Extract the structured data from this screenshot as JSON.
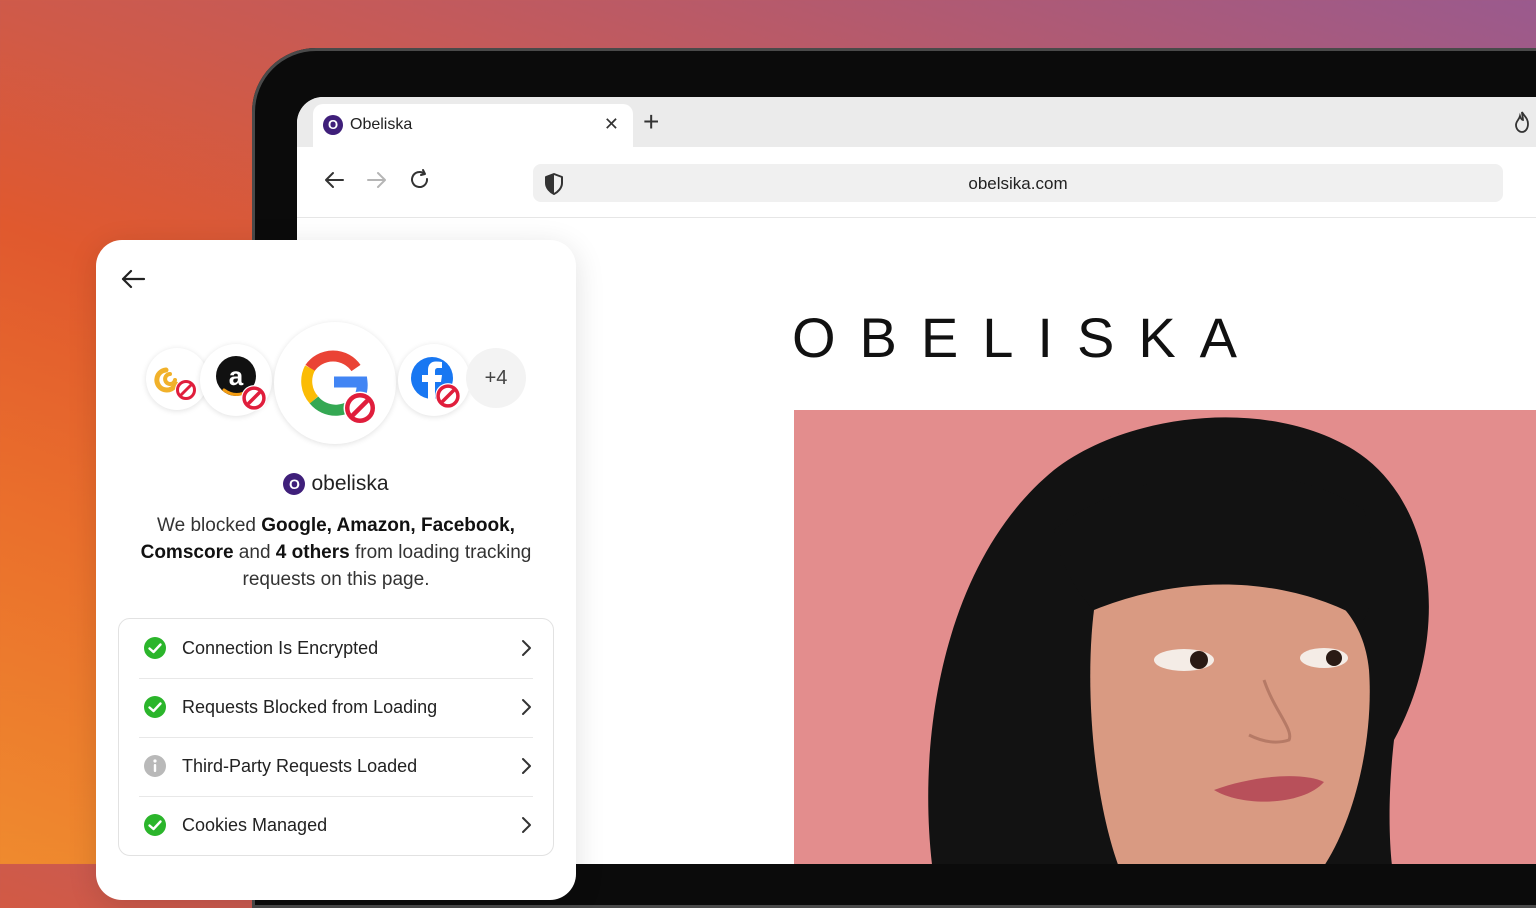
{
  "browser": {
    "tab_title": "Obeliska",
    "tab_favicon_letter": "O",
    "url": "obelsika.com"
  },
  "website": {
    "logo_text": "OBELISKA"
  },
  "panel": {
    "trackers": [
      {
        "name": "Comscore",
        "icon": "comscore-icon"
      },
      {
        "name": "Amazon",
        "icon": "amazon-icon"
      },
      {
        "name": "Google",
        "icon": "google-icon"
      },
      {
        "name": "Facebook",
        "icon": "facebook-icon"
      }
    ],
    "more_count": "+4",
    "site_badge_letter": "O",
    "site_name": "obeliska",
    "summary": {
      "prefix": "We blocked ",
      "bold_1": "Google, Amazon, Facebook,",
      "bold_2": "Comscore",
      "middle": " and ",
      "bold_3": "4 others",
      "suffix": " from loading tracking requests on this page."
    },
    "items": [
      {
        "label": "Connection Is Encrypted",
        "status": "ok",
        "icon": "check-circle-icon"
      },
      {
        "label": "Requests Blocked from Loading",
        "status": "ok",
        "icon": "check-circle-icon"
      },
      {
        "label": "Third-Party Requests Loaded",
        "status": "info",
        "icon": "info-circle-icon"
      },
      {
        "label": "Cookies Managed",
        "status": "ok",
        "icon": "check-circle-icon"
      }
    ]
  },
  "colors": {
    "brand_purple": "#3f1f7a",
    "check_green": "#2bb52b",
    "block_red": "#e01e3c",
    "hero_bg": "#e38d8d"
  }
}
